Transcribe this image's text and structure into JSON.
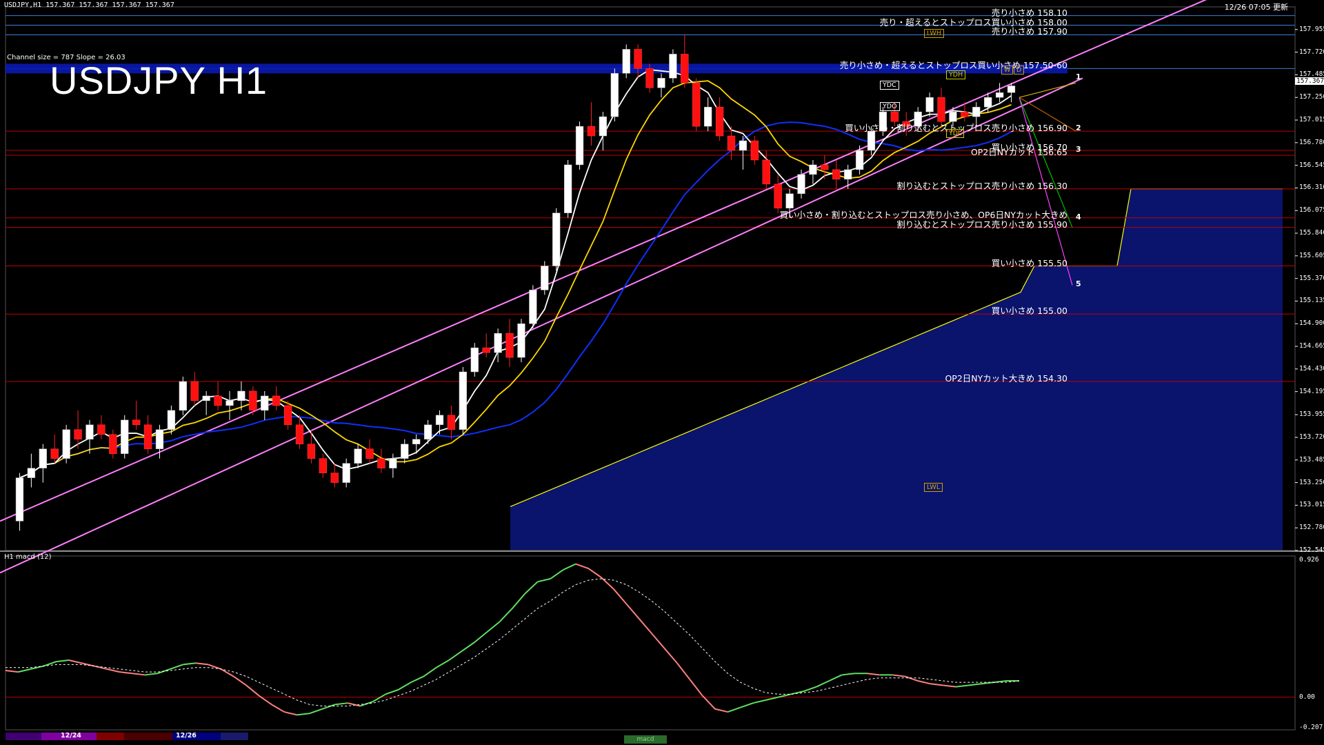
{
  "header": {
    "symbol_line": "USDJPY,H1  157.367 157.367 157.367 157.367",
    "updated": "12/26 07:05 更新",
    "channel_info": "Channel size = 787 Slope = 26.03",
    "big_title": "USDJPY H1",
    "macd_label": "H1  macd (12)"
  },
  "colors": {
    "background": "#000000",
    "price_line_red": "#c00000",
    "price_line_blue": "#3c7fd6",
    "channel": "#ff80ff",
    "cloud_top": "#ffff00",
    "cloud_fill": "#1a2a99",
    "ma_white": "#ffffff",
    "ma_yellow": "#ffd800",
    "ma_blue": "#1030ff",
    "chikou": "#00c800",
    "macd_up": "#60e060",
    "macd_down": "#ff8080",
    "signal": "#ffffff"
  },
  "chart_data": {
    "type": "candlestick",
    "symbol": "USDJPY",
    "timeframe": "H1",
    "ylim": [
      152.545,
      158.19
    ],
    "y_ticks": [
      "157.955",
      "157.720",
      "157.485",
      "157.250",
      "157.015",
      "156.780",
      "156.545",
      "156.310",
      "156.075",
      "155.840",
      "155.605",
      "155.370",
      "155.135",
      "154.900",
      "154.665",
      "154.430",
      "154.195",
      "153.955",
      "153.720",
      "153.485",
      "153.250",
      "153.015",
      "152.780",
      "152.545"
    ],
    "current_price": "157.367",
    "candles": [
      [
        152.85,
        153.35,
        152.75,
        153.3
      ],
      [
        153.3,
        153.55,
        153.2,
        153.4
      ],
      [
        153.4,
        153.65,
        153.25,
        153.6
      ],
      [
        153.6,
        153.75,
        153.45,
        153.5
      ],
      [
        153.5,
        153.85,
        153.45,
        153.8
      ],
      [
        153.8,
        154.0,
        153.6,
        153.7
      ],
      [
        153.7,
        153.9,
        153.55,
        153.85
      ],
      [
        153.85,
        153.95,
        153.7,
        153.75
      ],
      [
        153.75,
        153.8,
        153.5,
        153.55
      ],
      [
        153.55,
        153.95,
        153.5,
        153.9
      ],
      [
        153.9,
        154.1,
        153.8,
        153.85
      ],
      [
        153.85,
        153.95,
        153.55,
        153.6
      ],
      [
        153.6,
        153.85,
        153.5,
        153.8
      ],
      [
        153.8,
        154.05,
        153.75,
        154.0
      ],
      [
        154.0,
        154.35,
        153.95,
        154.3
      ],
      [
        154.3,
        154.4,
        154.05,
        154.1
      ],
      [
        154.1,
        154.2,
        153.95,
        154.15
      ],
      [
        154.15,
        154.3,
        154.0,
        154.05
      ],
      [
        154.05,
        154.2,
        153.9,
        154.1
      ],
      [
        154.1,
        154.3,
        154.0,
        154.2
      ],
      [
        154.2,
        154.25,
        153.95,
        154.0
      ],
      [
        154.0,
        154.2,
        153.9,
        154.15
      ],
      [
        154.15,
        154.25,
        154.0,
        154.05
      ],
      [
        154.05,
        154.1,
        153.8,
        153.85
      ],
      [
        153.85,
        153.95,
        153.6,
        153.65
      ],
      [
        153.65,
        153.8,
        153.45,
        153.5
      ],
      [
        153.5,
        153.55,
        153.3,
        153.35
      ],
      [
        153.35,
        153.45,
        153.2,
        153.25
      ],
      [
        153.25,
        153.5,
        153.2,
        153.45
      ],
      [
        153.45,
        153.65,
        153.4,
        153.6
      ],
      [
        153.6,
        153.7,
        153.45,
        153.5
      ],
      [
        153.5,
        153.6,
        153.35,
        153.4
      ],
      [
        153.4,
        153.55,
        153.3,
        153.5
      ],
      [
        153.5,
        153.7,
        153.45,
        153.65
      ],
      [
        153.65,
        153.75,
        153.55,
        153.7
      ],
      [
        153.7,
        153.9,
        153.65,
        153.85
      ],
      [
        153.85,
        154.0,
        153.75,
        153.95
      ],
      [
        153.95,
        154.05,
        153.7,
        153.8
      ],
      [
        153.8,
        154.45,
        153.75,
        154.4
      ],
      [
        154.4,
        154.7,
        154.35,
        154.65
      ],
      [
        154.65,
        154.8,
        154.55,
        154.6
      ],
      [
        154.6,
        154.85,
        154.5,
        154.8
      ],
      [
        154.8,
        154.95,
        154.45,
        154.55
      ],
      [
        154.55,
        154.95,
        154.5,
        154.9
      ],
      [
        154.9,
        155.3,
        154.85,
        155.25
      ],
      [
        155.25,
        155.55,
        155.2,
        155.5
      ],
      [
        155.5,
        156.1,
        155.45,
        156.05
      ],
      [
        156.05,
        156.6,
        156.0,
        156.55
      ],
      [
        156.55,
        157.0,
        156.5,
        156.95
      ],
      [
        156.95,
        157.2,
        156.75,
        156.85
      ],
      [
        156.85,
        157.1,
        156.7,
        157.05
      ],
      [
        157.05,
        157.55,
        157.0,
        157.5
      ],
      [
        157.5,
        157.8,
        157.45,
        157.75
      ],
      [
        157.75,
        157.8,
        157.45,
        157.55
      ],
      [
        157.55,
        157.6,
        157.3,
        157.35
      ],
      [
        157.35,
        157.5,
        157.25,
        157.45
      ],
      [
        157.45,
        157.75,
        157.4,
        157.7
      ],
      [
        157.7,
        157.9,
        157.35,
        157.4
      ],
      [
        157.4,
        157.45,
        156.9,
        156.95
      ],
      [
        156.95,
        157.25,
        156.9,
        157.15
      ],
      [
        157.15,
        157.25,
        156.8,
        156.85
      ],
      [
        156.85,
        156.95,
        156.6,
        156.7
      ],
      [
        156.7,
        156.85,
        156.5,
        156.8
      ],
      [
        156.8,
        156.85,
        156.55,
        156.6
      ],
      [
        156.6,
        156.7,
        156.3,
        156.35
      ],
      [
        156.35,
        156.45,
        156.05,
        156.1
      ],
      [
        156.1,
        156.3,
        156.0,
        156.25
      ],
      [
        156.25,
        156.5,
        156.2,
        156.45
      ],
      [
        156.45,
        156.6,
        156.35,
        156.55
      ],
      [
        156.55,
        156.65,
        156.4,
        156.5
      ],
      [
        156.5,
        156.6,
        156.3,
        156.4
      ],
      [
        156.4,
        156.55,
        156.3,
        156.5
      ],
      [
        156.5,
        156.75,
        156.45,
        156.7
      ],
      [
        156.7,
        156.95,
        156.65,
        156.9
      ],
      [
        156.9,
        157.15,
        156.85,
        157.1
      ],
      [
        157.1,
        157.2,
        156.95,
        157.0
      ],
      [
        157.0,
        157.1,
        156.85,
        156.95
      ],
      [
        156.95,
        157.15,
        156.9,
        157.1
      ],
      [
        157.1,
        157.3,
        157.05,
        157.25
      ],
      [
        157.25,
        157.35,
        156.95,
        157.0
      ],
      [
        157.0,
        157.15,
        156.95,
        157.1
      ],
      [
        157.1,
        157.2,
        157.0,
        157.05
      ],
      [
        157.05,
        157.2,
        156.95,
        157.15
      ],
      [
        157.15,
        157.3,
        157.1,
        157.25
      ],
      [
        157.25,
        157.4,
        157.2,
        157.3
      ],
      [
        157.3,
        157.4,
        157.2,
        157.37
      ]
    ],
    "horizontal_levels": [
      {
        "price": 158.1,
        "color": "#3c7fd6",
        "label": "売り小さめ 158.10"
      },
      {
        "price": 158.0,
        "color": "#3c7fd6",
        "label": "売り・超えるとストップロス買い小さめ 158.00"
      },
      {
        "price": 157.9,
        "color": "#3c7fd6",
        "label": "売り小さめ 157.90"
      },
      {
        "price": 157.55,
        "color": "#3c7fd6",
        "label": "売り小さめ・超えるとストップロス買い小さめ 157.50-60"
      },
      {
        "price": 156.9,
        "color": "#c00000",
        "label": "買い小さめ・割り込むとストップロス売り小さめ 156.90"
      },
      {
        "price": 156.7,
        "color": "#c00000",
        "label": "買い小さめ 156.70"
      },
      {
        "price": 156.65,
        "color": "#c00000",
        "label": "OP2日NYカット 156.65"
      },
      {
        "price": 156.3,
        "color": "#c00000",
        "label": "割り込むとストップロス売り小さめ 156.30"
      },
      {
        "price": 156.0,
        "color": "#c00000",
        "label": "買い小さめ・割り込むとストップロス売り小さめ、OP6日NYカット大きめ"
      },
      {
        "price": 155.9,
        "color": "#c00000",
        "label": "割り込むとストップロス売り小さめ 155.90"
      },
      {
        "price": 155.5,
        "color": "#c00000",
        "label": "買い小さめ 155.50"
      },
      {
        "price": 155.0,
        "color": "#c00000",
        "label": "買い小さめ 155.00"
      },
      {
        "price": 154.3,
        "color": "#c00000",
        "label": "OP2日NYカット大きめ 154.30"
      }
    ],
    "tags": [
      "LWH",
      "YDH",
      "YDC",
      "YDO",
      "YDL",
      "LWL",
      "W",
      "D"
    ],
    "wave_labels": [
      "1",
      "2",
      "3",
      "4",
      "5"
    ],
    "macd": {
      "label": "H1 macd (12)",
      "y_ticks": [
        "0.926",
        "0.00",
        "-0.207"
      ],
      "ylim": [
        -0.207,
        0.926
      ],
      "values": [
        0.18,
        0.17,
        0.19,
        0.21,
        0.24,
        0.25,
        0.23,
        0.21,
        0.19,
        0.17,
        0.16,
        0.15,
        0.16,
        0.19,
        0.22,
        0.23,
        0.22,
        0.19,
        0.14,
        0.08,
        0.01,
        -0.05,
        -0.1,
        -0.12,
        -0.11,
        -0.08,
        -0.05,
        -0.04,
        -0.06,
        -0.03,
        0.02,
        0.05,
        0.1,
        0.14,
        0.2,
        0.25,
        0.31,
        0.37,
        0.44,
        0.51,
        0.6,
        0.7,
        0.78,
        0.8,
        0.86,
        0.9,
        0.87,
        0.81,
        0.73,
        0.63,
        0.53,
        0.43,
        0.33,
        0.23,
        0.12,
        0.01,
        -0.08,
        -0.1,
        -0.07,
        -0.04,
        -0.02,
        0.0,
        0.02,
        0.04,
        0.07,
        0.11,
        0.15,
        0.16,
        0.16,
        0.15,
        0.15,
        0.14,
        0.11,
        0.09,
        0.08,
        0.07,
        0.08,
        0.09,
        0.1,
        0.11,
        0.11
      ],
      "signal": [
        0.2,
        0.2,
        0.2,
        0.21,
        0.22,
        0.22,
        0.22,
        0.21,
        0.2,
        0.19,
        0.18,
        0.17,
        0.17,
        0.18,
        0.19,
        0.2,
        0.2,
        0.19,
        0.17,
        0.14,
        0.1,
        0.06,
        0.02,
        -0.02,
        -0.05,
        -0.06,
        -0.06,
        -0.06,
        -0.05,
        -0.04,
        -0.02,
        0.01,
        0.04,
        0.08,
        0.12,
        0.17,
        0.22,
        0.27,
        0.33,
        0.39,
        0.46,
        0.53,
        0.6,
        0.65,
        0.71,
        0.76,
        0.79,
        0.8,
        0.79,
        0.76,
        0.71,
        0.65,
        0.58,
        0.5,
        0.42,
        0.33,
        0.24,
        0.16,
        0.1,
        0.06,
        0.03,
        0.02,
        0.02,
        0.03,
        0.04,
        0.06,
        0.08,
        0.1,
        0.12,
        0.13,
        0.13,
        0.13,
        0.13,
        0.12,
        0.11,
        0.1,
        0.1,
        0.1,
        0.1,
        0.1,
        0.11
      ]
    },
    "dates": [
      "12/24",
      "12/26"
    ]
  }
}
